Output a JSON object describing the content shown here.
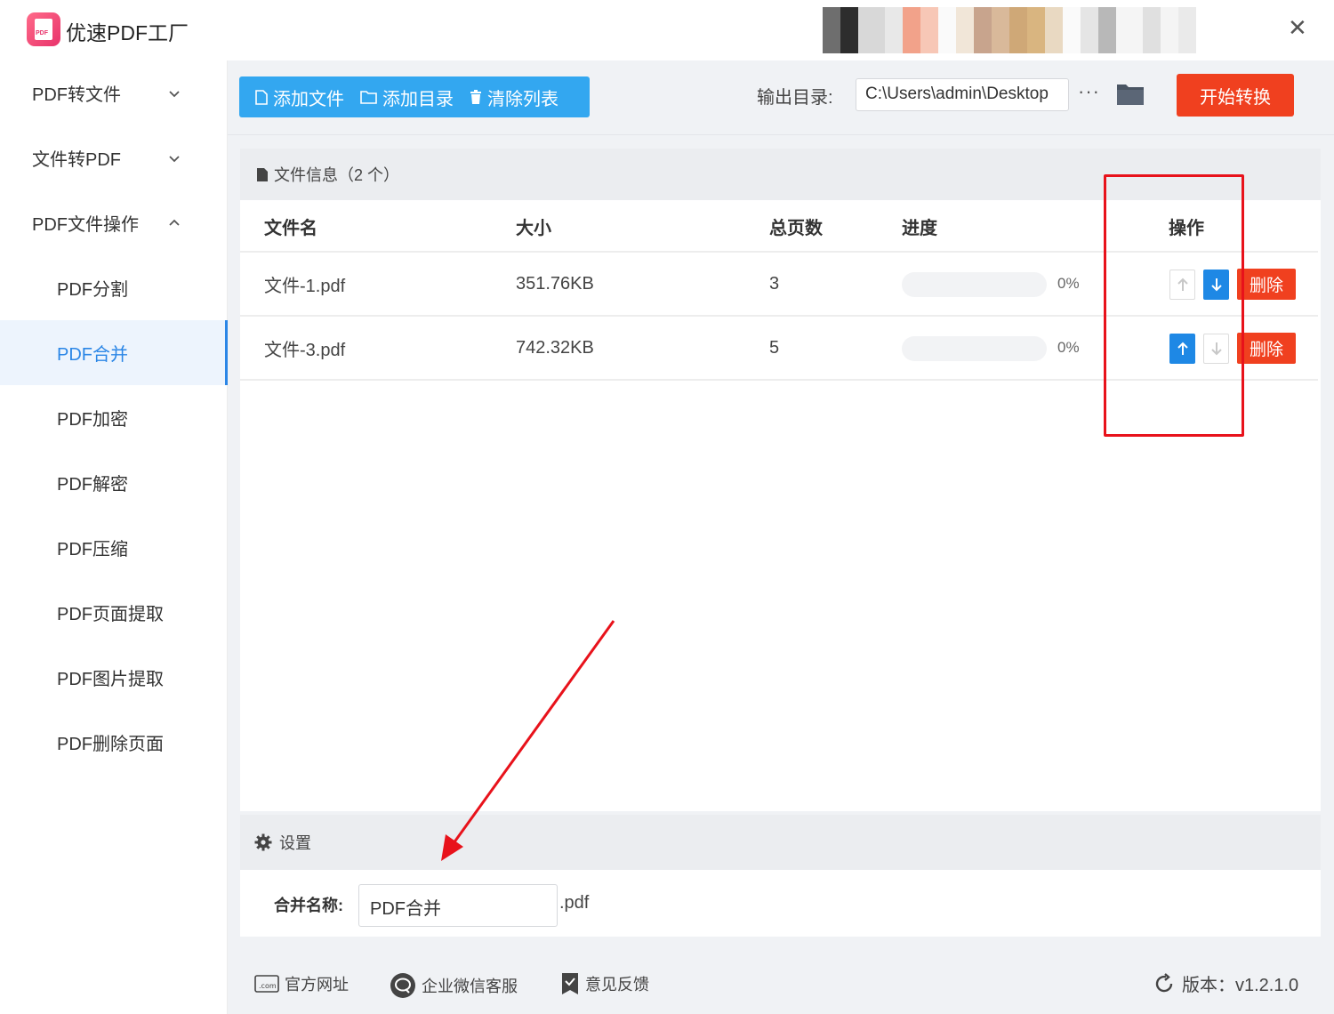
{
  "app": {
    "title": "优速PDF工厂",
    "logo_text": "PDF"
  },
  "window_controls": {
    "minimize": "—",
    "close": "✕"
  },
  "sidebar": {
    "groups": [
      {
        "label": "PDF转文件",
        "expanded": false
      },
      {
        "label": "文件转PDF",
        "expanded": false
      },
      {
        "label": "PDF文件操作",
        "expanded": true
      }
    ],
    "sub_items": [
      {
        "label": "PDF分割",
        "active": false
      },
      {
        "label": "PDF合并",
        "active": true
      },
      {
        "label": "PDF加密",
        "active": false
      },
      {
        "label": "PDF解密",
        "active": false
      },
      {
        "label": "PDF压缩",
        "active": false
      },
      {
        "label": "PDF页面提取",
        "active": false
      },
      {
        "label": "PDF图片提取",
        "active": false
      },
      {
        "label": "PDF删除页面",
        "active": false
      }
    ]
  },
  "toolbar": {
    "add_file": "添加文件",
    "add_dir": "添加目录",
    "clear_list": "清除列表",
    "output_label": "输出目录:",
    "output_path": "C:\\Users\\admin\\Desktop",
    "more": "···",
    "start": "开始转换"
  },
  "file_panel": {
    "title": "文件信息（2 个）",
    "columns": {
      "name": "文件名",
      "size": "大小",
      "pages": "总页数",
      "progress": "进度",
      "actions": "操作"
    },
    "rows": [
      {
        "name": "文件-1.pdf",
        "size": "351.76KB",
        "pages": "3",
        "progress": 0,
        "progress_label": "0%",
        "can_up": false,
        "can_down": true,
        "delete": "删除"
      },
      {
        "name": "文件-3.pdf",
        "size": "742.32KB",
        "pages": "5",
        "progress": 0,
        "progress_label": "0%",
        "can_up": true,
        "can_down": false,
        "delete": "删除"
      }
    ]
  },
  "settings": {
    "title": "设置",
    "merge_label": "合并名称:",
    "merge_value": "PDF合并",
    "ext": ".pdf"
  },
  "footer": {
    "website": "官方网址",
    "wechat": "企业微信客服",
    "feedback": "意见反馈",
    "version": "版本：v1.2.1.0"
  },
  "colors": {
    "accent": "#33a7f0",
    "active_blue": "#2b86e6",
    "danger": "#f0401f",
    "annotation_red": "#e8121b"
  },
  "icons": [
    "logo-icon",
    "chevron-down-icon",
    "chevron-up-icon",
    "file-icon",
    "folder-outline-icon",
    "trash-icon",
    "ellipsis-icon",
    "folder-icon",
    "document-icon",
    "arrow-up-icon",
    "arrow-down-icon",
    "gear-icon",
    "dotcom-icon",
    "chat-icon",
    "feedback-icon",
    "refresh-icon"
  ]
}
